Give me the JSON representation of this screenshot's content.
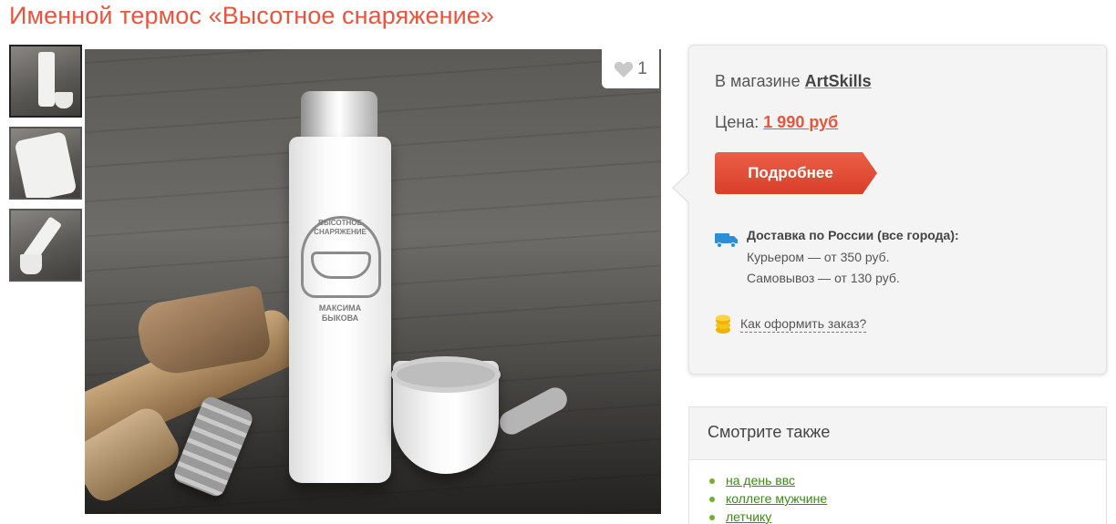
{
  "product": {
    "title": "Именной термос «Высотное снаряжение»",
    "engraving_top": "ВЫСОТНОЕ СНАРЯЖЕНИЕ",
    "engraving_bottom": "МАКСИМА БЫКОВА",
    "likes": "1"
  },
  "thumbnails": [
    {
      "name": "thumbnail-1",
      "active": true
    },
    {
      "name": "thumbnail-2",
      "active": false
    },
    {
      "name": "thumbnail-3",
      "active": false
    }
  ],
  "shop": {
    "in_store_label": "В магазине",
    "store_name": "ArtSkills",
    "price_label": "Цена:",
    "price": "1 990 руб",
    "details_button": "Подробнее",
    "delivery_title": "Доставка по России (все города):",
    "courier": "Курьером — от 350 руб.",
    "pickup": "Самовывоз — от 130 руб.",
    "how_to_order": "Как оформить заказ?"
  },
  "see_also": {
    "heading": "Смотрите также",
    "links": [
      "на день ввс",
      "коллеге мужчине",
      "летчику"
    ]
  },
  "colors": {
    "accent": "#e8553f",
    "link_green": "#3d8a10",
    "bullet_green": "#6fb22a",
    "panel_bg": "#f3f4f3"
  },
  "icons": [
    "heart-icon",
    "truck-icon",
    "coins-icon"
  ]
}
